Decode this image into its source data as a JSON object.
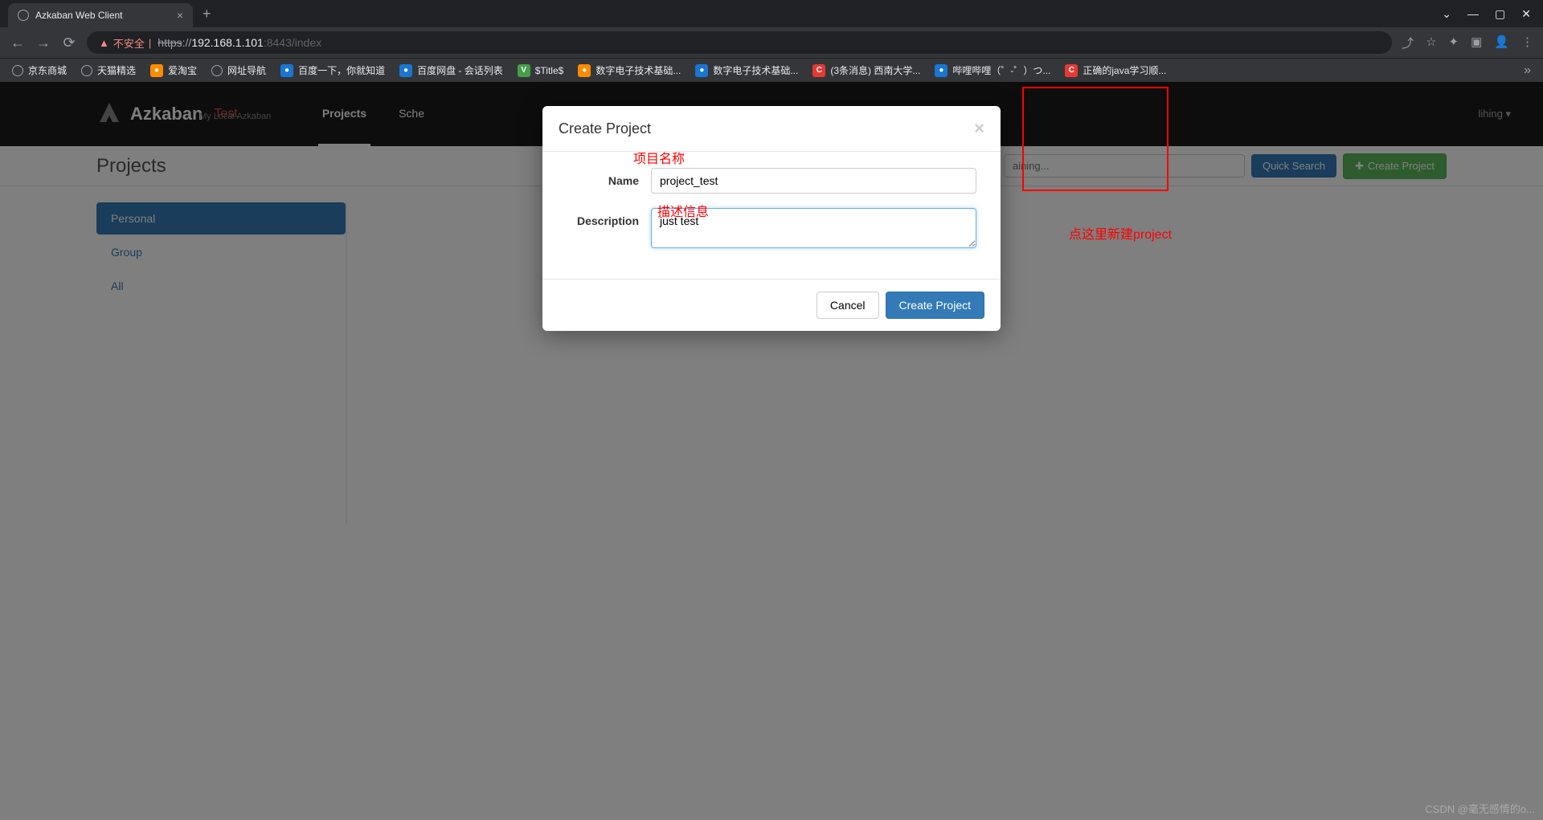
{
  "browser": {
    "tab_title": "Azkaban Web Client",
    "url_warning": "不安全",
    "url_prefix": "https",
    "url_host": "192.168.1.101",
    "url_port_path": ":8443/index",
    "bookmarks": [
      {
        "label": "京东商城",
        "icon": "globe"
      },
      {
        "label": "天猫精选",
        "icon": "globe"
      },
      {
        "label": "爱淘宝",
        "icon": "orange"
      },
      {
        "label": "网址导航",
        "icon": "globe"
      },
      {
        "label": "百度一下，你就知道",
        "icon": "blue"
      },
      {
        "label": "百度网盘 - 会话列表",
        "icon": "blue"
      },
      {
        "label": "$Title$",
        "icon": "green"
      },
      {
        "label": "数字电子技术基础...",
        "icon": "orange"
      },
      {
        "label": "数字电子技术基础...",
        "icon": "blue"
      },
      {
        "label": "(3条消息) 西南大学...",
        "icon": "red"
      },
      {
        "label": "哔哩哔哩（゜-゜）つ...",
        "icon": "blue"
      },
      {
        "label": "正确的java学习顺...",
        "icon": "red"
      }
    ]
  },
  "azkaban": {
    "brand": "Azkaban",
    "brand_sub": "Test",
    "tagline": "My Local Azkaban",
    "nav": {
      "projects": "Projects",
      "scheduling": "Sche"
    },
    "user": "lihing",
    "page_title": "Projects",
    "search_placeholder": "aining...",
    "quick_search": "Quick Search",
    "create_project": "Create Project",
    "sidebar": [
      {
        "label": "Personal",
        "active": true
      },
      {
        "label": "Group",
        "active": false
      },
      {
        "label": "All",
        "active": false
      }
    ]
  },
  "modal": {
    "title": "Create Project",
    "name_label": "Name",
    "name_value": "project_test",
    "desc_label": "Description",
    "desc_value": "just test",
    "cancel": "Cancel",
    "create": "Create Project"
  },
  "annotations": {
    "name_hint": "项目名称",
    "desc_hint": "描述信息",
    "create_hint": "点这里新建project",
    "watermark": "CSDN @毫无感情的o..."
  }
}
